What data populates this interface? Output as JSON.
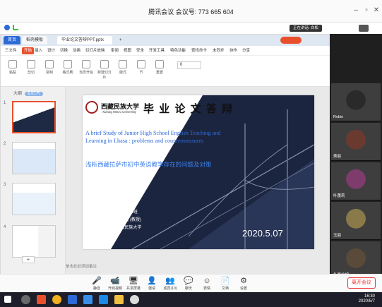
{
  "window": {
    "title": "腾讯会议 会议号: 773 665 604",
    "controls": [
      "minimize-icon",
      "restore-icon",
      "close-icon"
    ]
  },
  "meeting_bar": {
    "speaker_label": "正在讲话: 白松"
  },
  "wps": {
    "tabs": [
      "首页",
      "稻壳模板",
      "毕业论文答辩PPT.pptx",
      "+"
    ],
    "menu": [
      "三文件",
      "开始",
      "插入",
      "设计",
      "切换",
      "动画",
      "幻灯片放映",
      "审阅",
      "视图",
      "安全",
      "开发工具",
      "特色功能",
      "查找命令",
      "未同步",
      "协作",
      "分享"
    ],
    "active_menu": "开始",
    "ribbon": [
      "粘贴",
      "剪切",
      "复制",
      "格式刷",
      "当页开始",
      "新建幻灯片",
      "版式",
      "节",
      "重置"
    ],
    "font_size": "0",
    "panel_head": {
      "label": "大纲",
      "tag": "幻灯片"
    },
    "slide_numbers": [
      "1",
      "2",
      "3",
      "4"
    ],
    "notes_placeholder": "单击此处添加备注"
  },
  "slide": {
    "university_cn": "西藏民族大学",
    "university_en": "Xizang Minzu University",
    "heading": "毕 业 论 文 答 辩",
    "en_title_line1": "A brief Study of Junior High School English Teaching and",
    "en_title_line2": "Learning in Lhasa : problems and countermeasures",
    "cn_subtitle": "浅析西藏拉萨市初中英语教学存在的问题及对策",
    "info": [
      "答辩人: 白珍",
      "班级: 16级英师本二班",
      "指导老师: 刘晓艳 (教授)",
      "学校名称: 西藏民族大学"
    ],
    "date": "2020.5.07"
  },
  "participants": [
    {
      "name": "Robin",
      "tone": "#2a2a2a"
    },
    {
      "name": "美丽",
      "tone": "#6b3a2f"
    },
    {
      "name": "叶蕾莉",
      "tone": "#7d3c6b"
    },
    {
      "name": "玉丽",
      "tone": "#8a7a4a"
    },
    {
      "name": "扎西拉姆",
      "tone": "#5a4a3a"
    }
  ],
  "toolbar": {
    "items": [
      {
        "label": "静音",
        "glyph": "🎤"
      },
      {
        "label": "开启视频",
        "glyph": "📹"
      },
      {
        "label": "共享屏幕",
        "glyph": "🖥"
      },
      {
        "label": "邀请",
        "glyph": "👤"
      },
      {
        "label": "成员(10)",
        "glyph": "👥"
      },
      {
        "label": "聊天",
        "glyph": "💬"
      },
      {
        "label": "表情",
        "glyph": "☺"
      },
      {
        "label": "文档",
        "glyph": "📄"
      },
      {
        "label": "设置",
        "glyph": "⚙"
      }
    ],
    "leave": "离开会议"
  },
  "taskbar": {
    "time": "16:30",
    "date": "2020/5/7"
  },
  "colors": {
    "wps_red": "#e8502d",
    "slide_blue": "#2c6ad6",
    "leave_red": "#e33333"
  }
}
